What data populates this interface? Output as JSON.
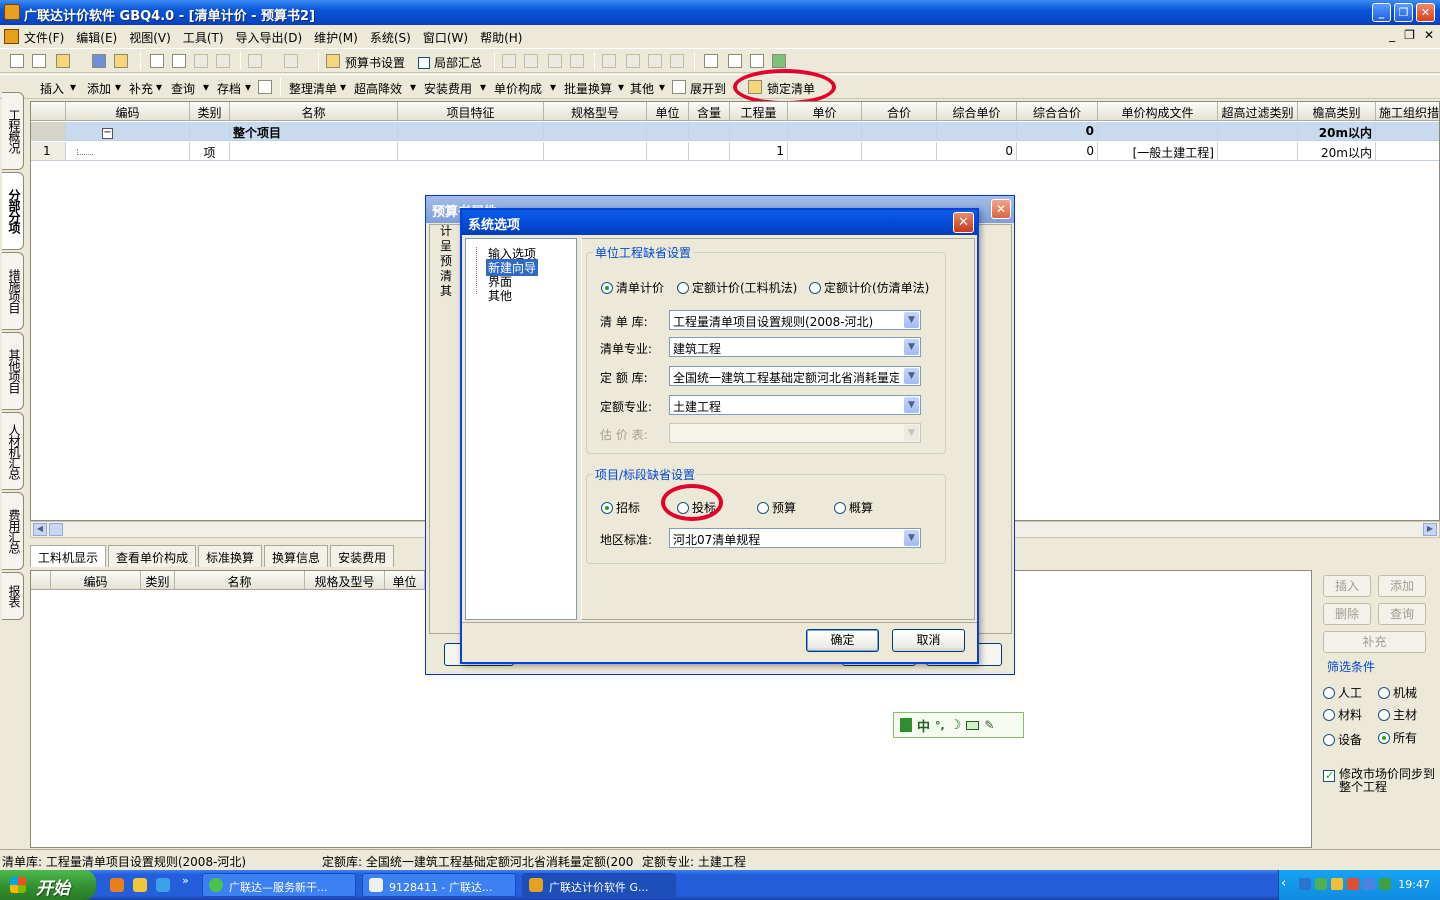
{
  "window": {
    "title": "广联达计价软件 GBQ4.0 - [清单计价 - 预算书2]",
    "controls": [
      "_",
      "❐",
      "✕"
    ]
  },
  "menubar": {
    "items": [
      "文件(F)",
      "编辑(E)",
      "视图(V)",
      "工具(T)",
      "导入导出(D)",
      "维护(M)",
      "系统(S)",
      "窗口(W)",
      "帮助(H)"
    ],
    "mdi_controls": [
      "_",
      "❐",
      "✕"
    ]
  },
  "toolbar1": {
    "budget_settings": "预算书设置",
    "partial_summary": "局部汇总"
  },
  "toolbar2": {
    "insert": "插入",
    "add": "添加",
    "supplement": "补充",
    "query": "查询",
    "save": "存档",
    "organize": "整理清单",
    "over_height": "超高降效",
    "install_fee": "安装费用",
    "unit_price_comp": "单价构成",
    "batch_convert": "批量换算",
    "other": "其他",
    "expand_to": "展开到",
    "lock_list": "锁定清单"
  },
  "left_tabs": [
    "工程概况",
    "分部分项",
    "措施项目",
    "其他项目",
    "人材机汇总",
    "费用汇总",
    "报表"
  ],
  "grid": {
    "columns": [
      "编码",
      "类别",
      "名称",
      "项目特征",
      "规格型号",
      "单位",
      "含量",
      "工程量",
      "单价",
      "合价",
      "综合单价",
      "综合合价",
      "单价构成文件",
      "超高过滤类别",
      "檐高类别",
      "施工组织措"
    ],
    "total_row": {
      "toggle": "−",
      "name": "整个项目",
      "composite_total": "0",
      "eave_category": "20m以内"
    },
    "rows": [
      {
        "index": "1",
        "code": "",
        "type": "项",
        "quantity": "1",
        "composite_price": "0",
        "composite_total": "0",
        "price_file": "[一般土建工程]",
        "eave_category": "20m以内"
      }
    ]
  },
  "sub_tabs": [
    "工料机显示",
    "查看单价构成",
    "标准换算",
    "换算信息",
    "安装费用"
  ],
  "sub_grid": {
    "columns": [
      "编码",
      "类别",
      "名称",
      "规格及型号",
      "单位"
    ]
  },
  "right_panel": {
    "buttons": [
      "插入",
      "添加",
      "删除",
      "查询",
      "补充"
    ],
    "filter_title": "筛选条件",
    "filters": [
      {
        "label": "人工",
        "checked": false
      },
      {
        "label": "机械",
        "checked": false
      },
      {
        "label": "材料",
        "checked": false
      },
      {
        "label": "主材",
        "checked": false
      },
      {
        "label": "设备",
        "checked": false
      },
      {
        "label": "所有",
        "checked": true
      }
    ],
    "sync_checkbox": "修改市场价同步到整个工程"
  },
  "statusbar": {
    "list_lib": "清单库:  工程量清单项目设置规则(2008-河北)",
    "quota_lib": "定额库:  全国统一建筑工程基础定额河北省消耗量定额(200",
    "quota_major": "定额专业:  土建工程"
  },
  "taskbar": {
    "start": "开始",
    "items": [
      "广联达—服务新干...",
      "9128411 - 广联达...",
      "广联达计价软件 G..."
    ],
    "clock": "19:47"
  },
  "back_dialog": {
    "title": "预算书属性",
    "tree_chars": [
      "计",
      "呈",
      "预",
      "清",
      "其"
    ]
  },
  "dialog": {
    "title": "系统选项",
    "nav": [
      "输入选项",
      "新建向导",
      "界面",
      "其他"
    ],
    "selected_nav": "新建向导",
    "unit_group": {
      "title": "单位工程缺省设置",
      "radios": [
        {
          "label": "清单计价",
          "checked": true
        },
        {
          "label": "定额计价(工料机法)",
          "checked": false
        },
        {
          "label": "定额计价(仿清单法)",
          "checked": false
        }
      ],
      "fields": [
        {
          "label": "清 单 库:",
          "value": "工程量清单项目设置规则(2008-河北)",
          "enabled": true
        },
        {
          "label": "清单专业:",
          "value": "建筑工程",
          "enabled": true
        },
        {
          "label": "定 额 库:",
          "value": "全国统一建筑工程基础定额河北省消耗量定",
          "enabled": true
        },
        {
          "label": "定额专业:",
          "value": "土建工程",
          "enabled": true
        },
        {
          "label": "估 价 表:",
          "value": "",
          "enabled": false
        }
      ]
    },
    "project_group": {
      "title": "项目/标段缺省设置",
      "radios": [
        {
          "label": "招标",
          "checked": true
        },
        {
          "label": "投标",
          "checked": false
        },
        {
          "label": "预算",
          "checked": false
        },
        {
          "label": "概算",
          "checked": false
        }
      ],
      "region_label": "地区标准:",
      "region_value": "河北07清单规程"
    },
    "ok": "确定",
    "cancel": "取消"
  },
  "ime": {
    "text": "中"
  }
}
